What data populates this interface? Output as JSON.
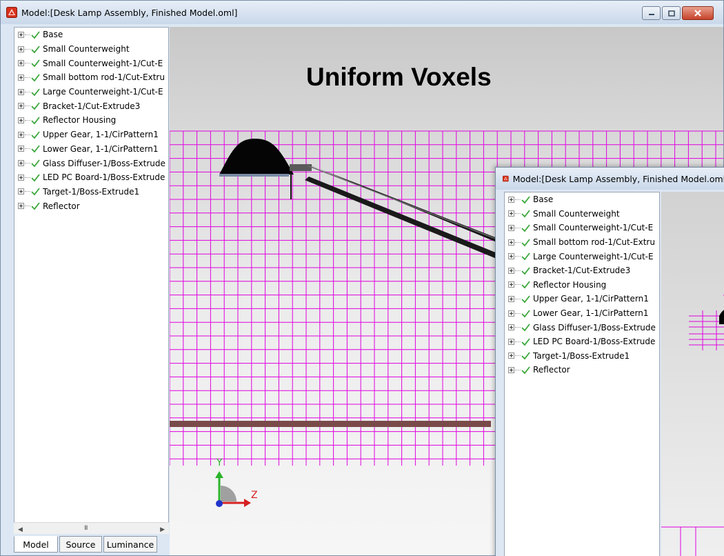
{
  "main_window": {
    "title": "Model:[Desk Lamp Assembly, Finished Model.oml]"
  },
  "secondary_window": {
    "title": "Model:[Desk Lamp Assembly, Finished Model.oml]"
  },
  "tree": {
    "items": [
      {
        "label": "Base"
      },
      {
        "label": "Small Counterweight"
      },
      {
        "label": "Small Counterweight-1/Cut-E"
      },
      {
        "label": "Small bottom rod-1/Cut-Extru"
      },
      {
        "label": "Large Counterweight-1/Cut-E"
      },
      {
        "label": "Bracket-1/Cut-Extrude3"
      },
      {
        "label": "Reflector Housing"
      },
      {
        "label": "Upper Gear, 1-1/CirPattern1"
      },
      {
        "label": "Lower Gear, 1-1/CirPattern1"
      },
      {
        "label": "Glass Diffuser-1/Boss-Extrude"
      },
      {
        "label": "LED PC Board-1/Boss-Extrude"
      },
      {
        "label": "Target-1/Boss-Extrude1"
      },
      {
        "label": "Reflector"
      }
    ]
  },
  "tabs": [
    {
      "label": "Model",
      "active": true
    },
    {
      "label": "Source",
      "active": false
    },
    {
      "label": "Luminance",
      "active": false
    }
  ],
  "scrollbar": {
    "grip": "III"
  },
  "viewport": {
    "caption": "Uniform Voxels",
    "axis_y": "Y",
    "axis_z": "Z"
  },
  "colors": {
    "voxel_grid": "#e000e0",
    "check": "#3aa63a",
    "axis_y": "#2bb32b",
    "axis_z": "#d62020",
    "axis_x": "#2233cc",
    "floor_bar": "#7a4a4a"
  },
  "icons": {
    "app": "app-red-icon",
    "expand": "plus-box-icon",
    "visible": "check-icon",
    "minimize": "minimize-icon",
    "maximize": "maximize-icon",
    "close": "close-icon"
  }
}
